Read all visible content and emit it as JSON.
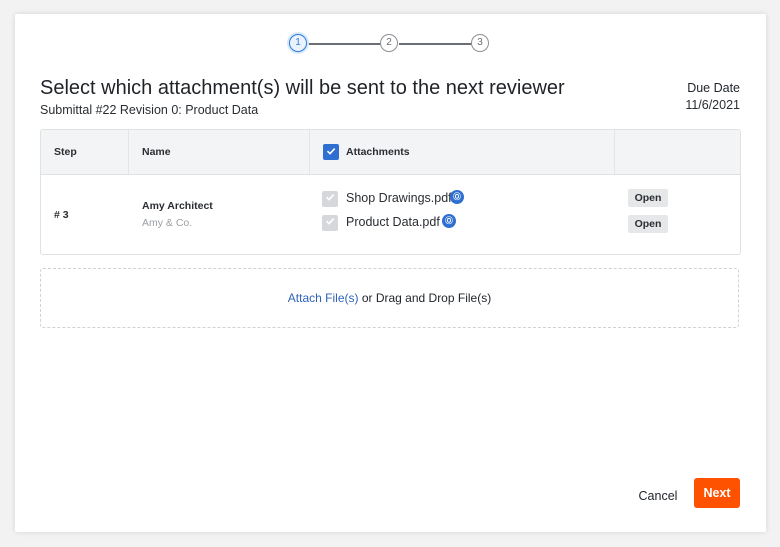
{
  "stepper": {
    "steps": [
      "1",
      "2",
      "3"
    ],
    "active_step": 1
  },
  "header": {
    "title": "Select which attachment(s) will be sent to the next reviewer",
    "subtitle": "Submittal #22 Revision 0: Product Data",
    "due_label": "Due Date",
    "due_value": "11/6/2021"
  },
  "table": {
    "columns": [
      "Step",
      "Name",
      "Attachments"
    ],
    "select_all_checked": true,
    "rows": [
      {
        "step": "# 3",
        "name": "Amy Architect",
        "company": "Amy & Co.",
        "attachments": [
          {
            "filename": "Shop Drawings.pdf",
            "checked": true,
            "badge": "Ⓞ",
            "action": "Open"
          },
          {
            "filename": "Product Data.pdf",
            "checked": true,
            "badge": "Ⓞ",
            "action": "Open"
          }
        ]
      }
    ]
  },
  "dropzone": {
    "link_label": "Attach File(s)",
    "text": " or Drag and Drop File(s)"
  },
  "footer": {
    "cancel_label": "Cancel",
    "next_label": "Next"
  },
  "colors": {
    "accent": "#2f6fd1",
    "primary_button": "#ff5200",
    "link": "#2f63b8"
  }
}
